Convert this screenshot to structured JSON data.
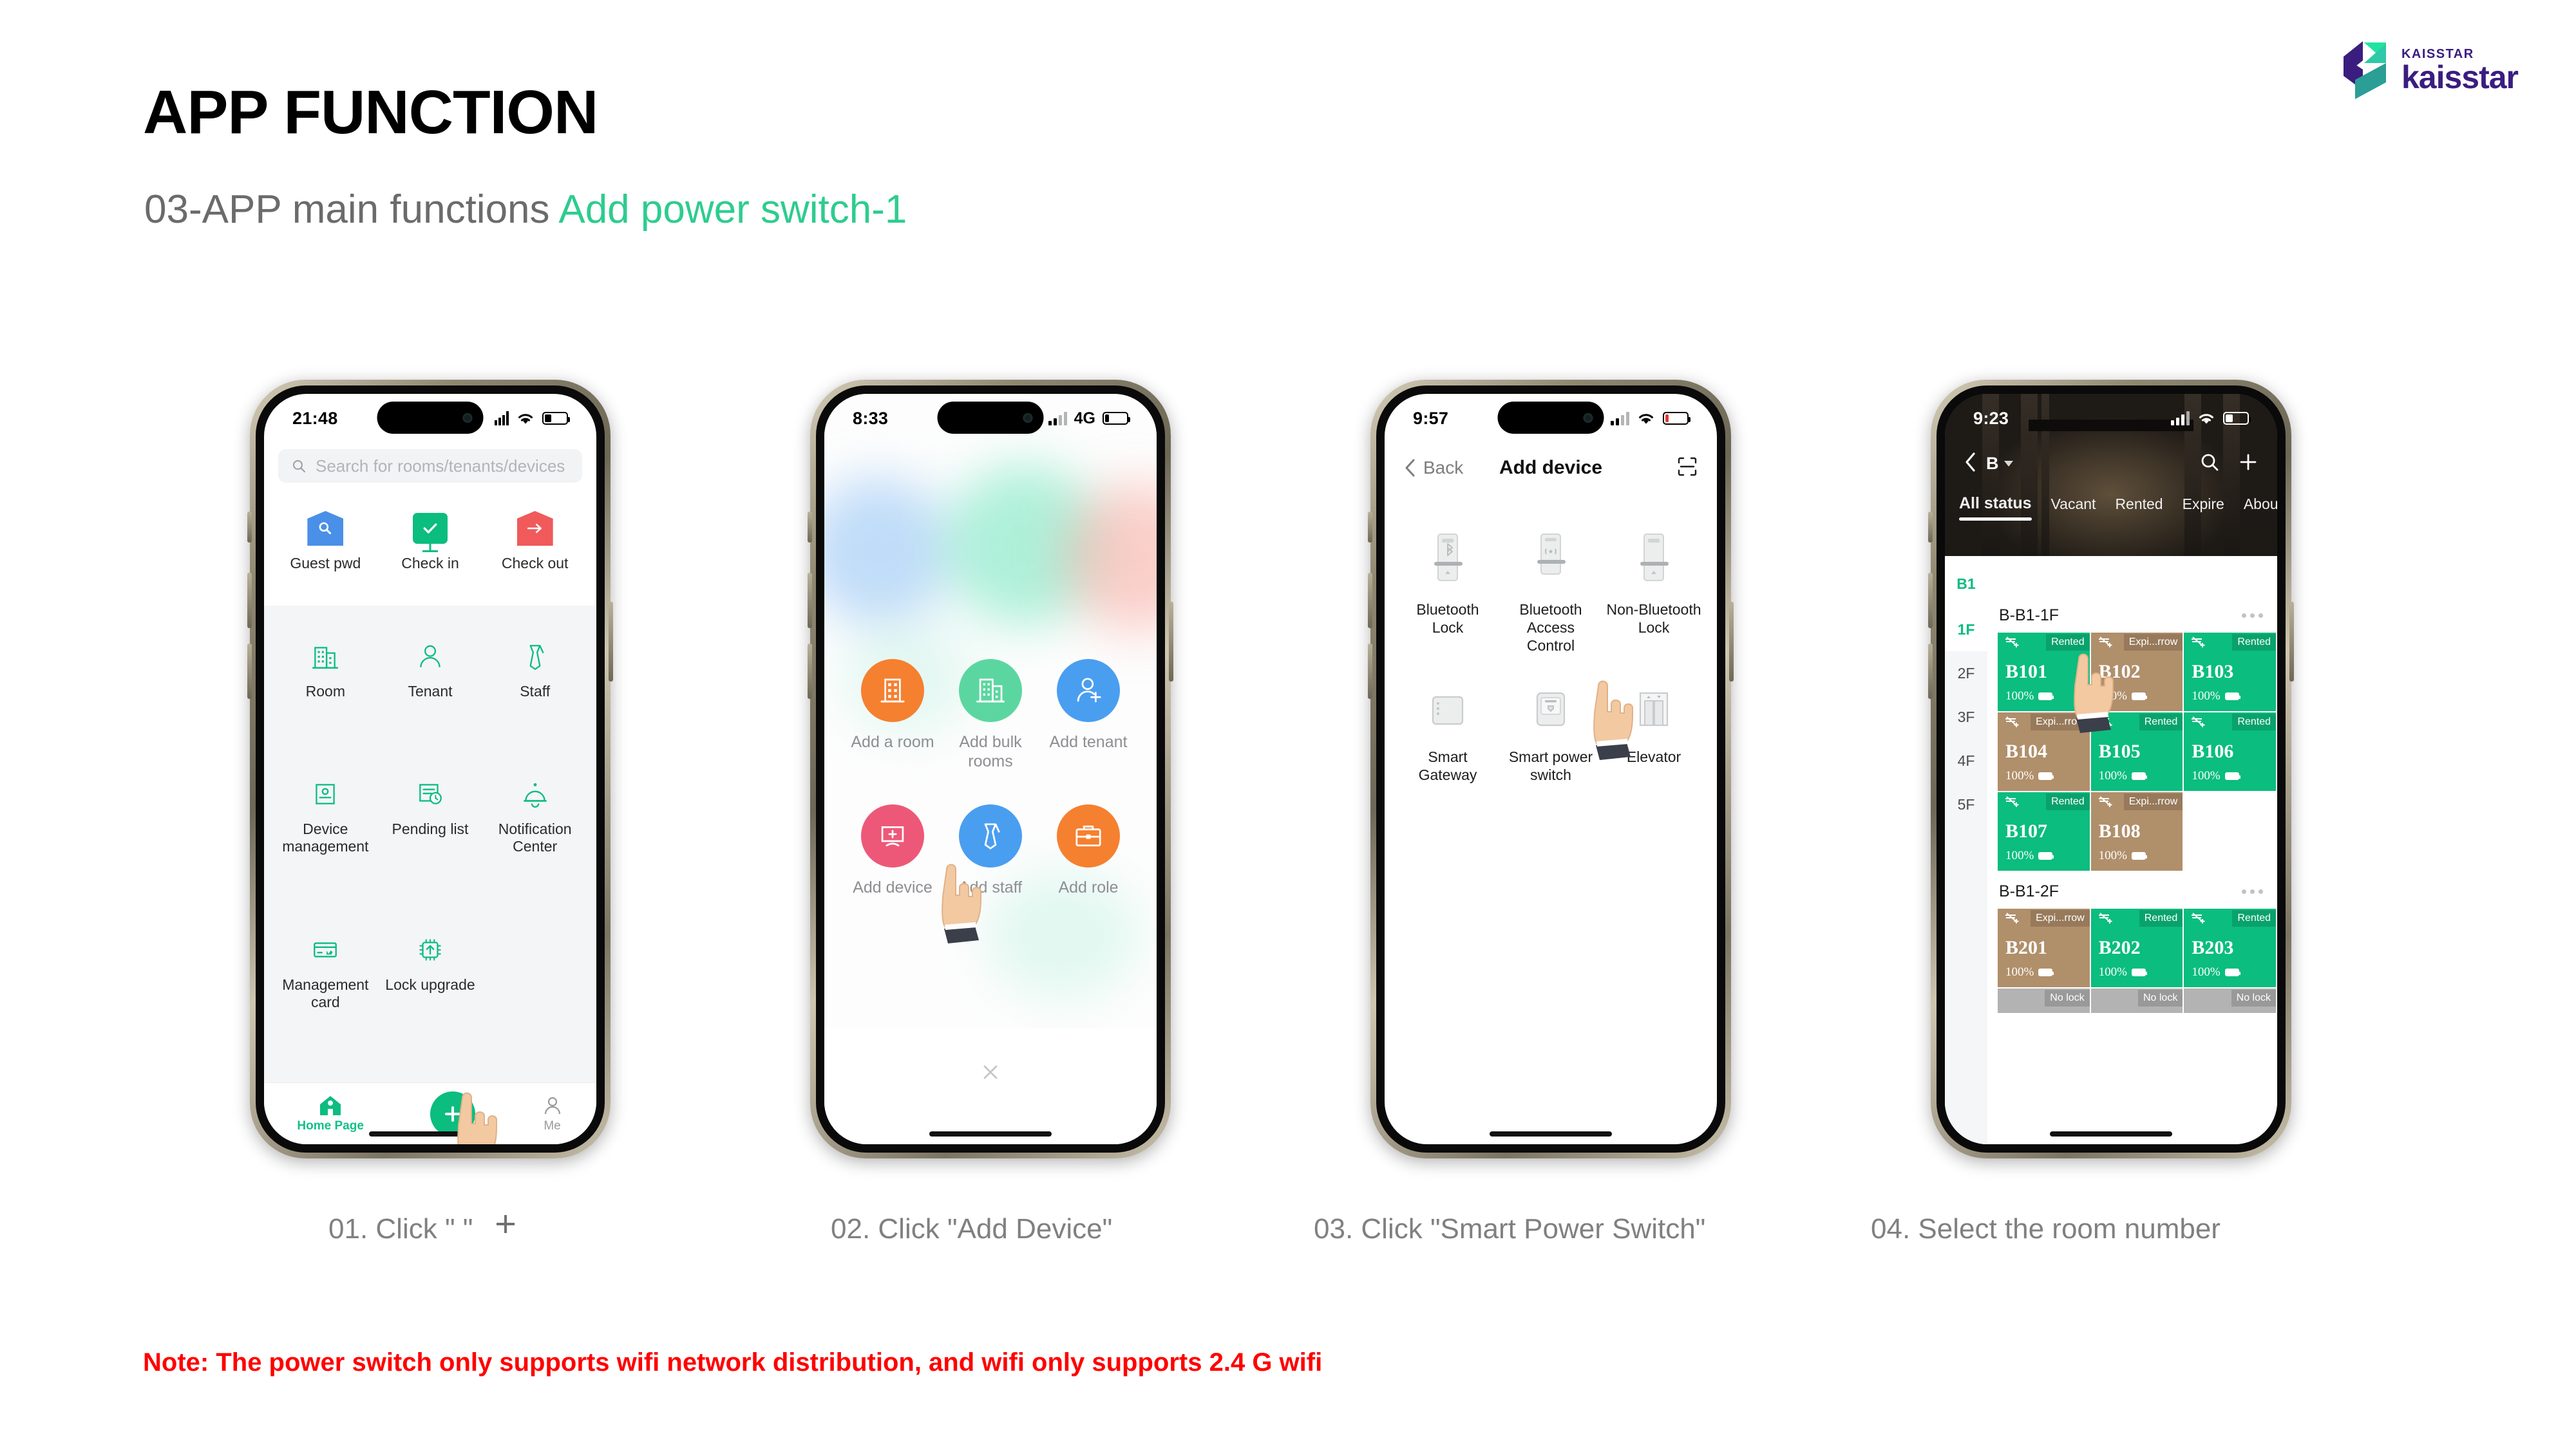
{
  "header": {
    "title": "APP FUNCTION",
    "subtitle_prefix": "03-APP main functions ",
    "subtitle_accent": "Add power switch-1",
    "accent_color": "#2ecc8f"
  },
  "logo": {
    "small_text": "KAISSTAR",
    "big_text": "kaisstar",
    "brand_color": "#3b1d80",
    "accent_color": "#1fd9a0"
  },
  "phone1": {
    "status": {
      "time": "21:48",
      "network": "",
      "battery_level": "30%"
    },
    "search": {
      "placeholder": "Search for rooms/tenants/devices"
    },
    "top_items": [
      {
        "label": "Guest pwd",
        "icon": "shield-search-icon",
        "color": "#4a90e8"
      },
      {
        "label": "Check in",
        "icon": "check-screen-icon",
        "color": "#0bbd7f"
      },
      {
        "label": "Check out",
        "icon": "shield-arrow-icon",
        "color": "#f05a5a"
      }
    ],
    "menu_items": [
      {
        "label": "Room",
        "icon": "building-icon"
      },
      {
        "label": "Tenant",
        "icon": "person-icon"
      },
      {
        "label": "Staff",
        "icon": "tie-icon"
      },
      {
        "label": "Device management",
        "icon": "device-card-icon"
      },
      {
        "label": "Pending list",
        "icon": "pending-clock-icon"
      },
      {
        "label": "Notification Center",
        "icon": "bell-icon"
      },
      {
        "label": "Management card",
        "icon": "management-card-icon"
      },
      {
        "label": "Lock upgrade",
        "icon": "chip-upload-icon"
      }
    ],
    "tabbar": [
      {
        "label": "Home Page",
        "icon": "home-icon",
        "active": true
      },
      {
        "label": "",
        "icon": "plus-fab-icon",
        "active": false
      },
      {
        "label": "Me",
        "icon": "person-outline-icon",
        "active": false
      }
    ]
  },
  "phone2": {
    "status": {
      "time": "8:33",
      "network": "4G",
      "battery_level": "20%"
    },
    "actions": [
      {
        "label": "Add a room",
        "icon": "building-icon",
        "color": "#f58030"
      },
      {
        "label": "Add bulk rooms",
        "icon": "buildings-icon",
        "color": "#5cd6a0"
      },
      {
        "label": "Add tenant",
        "icon": "person-plus-icon",
        "color": "#4a9ef0"
      },
      {
        "label": "Add device",
        "icon": "device-plus-icon",
        "color": "#ee5878"
      },
      {
        "label": "Add staff",
        "icon": "tie-icon",
        "color": "#4a9ef0"
      },
      {
        "label": "Add role",
        "icon": "briefcase-icon",
        "color": "#f58030"
      }
    ],
    "close_label": "close-icon"
  },
  "phone3": {
    "status": {
      "time": "9:57",
      "network": "",
      "battery_level": "15%"
    },
    "nav": {
      "back_label": "Back",
      "title": "Add device",
      "scan_icon": "scan-icon"
    },
    "devices": [
      {
        "label": "Bluetooth Lock",
        "icon": "bluetooth-lock-icon"
      },
      {
        "label": "Bluetooth Access Control",
        "icon": "bluetooth-access-icon"
      },
      {
        "label": "Non-Bluetooth Lock",
        "icon": "nonbluetooth-lock-icon"
      },
      {
        "label": "Smart Gateway",
        "icon": "gateway-icon"
      },
      {
        "label": "Smart power switch",
        "icon": "power-switch-icon"
      },
      {
        "label": "Elevator",
        "icon": "elevator-icon"
      }
    ]
  },
  "phone4": {
    "status": {
      "time": "9:23",
      "network": "",
      "battery_level": "35%"
    },
    "nav": {
      "building": "B",
      "back_icon": "back-chevron-icon",
      "dropdown_icon": "caret-down-icon",
      "search_icon": "search-icon",
      "add_icon": "plus-icon"
    },
    "tabs": [
      {
        "label": "All status",
        "active": true
      },
      {
        "label": "Vacant",
        "active": false
      },
      {
        "label": "Rented",
        "active": false
      },
      {
        "label": "Expire",
        "active": false
      },
      {
        "label": "About t",
        "active": false
      }
    ],
    "floors": [
      {
        "label": "B1",
        "selected": true,
        "header": true
      },
      {
        "label": "1F",
        "selected": true
      },
      {
        "label": "2F",
        "selected": false
      },
      {
        "label": "3F",
        "selected": false
      },
      {
        "label": "4F",
        "selected": false
      },
      {
        "label": "5F",
        "selected": false
      }
    ],
    "sections": [
      {
        "name": "B-B1-1F",
        "rooms": [
          {
            "number": "B101",
            "status": "Rented",
            "battery": "100%",
            "color": "green"
          },
          {
            "number": "B102",
            "status": "Expi...rrow",
            "battery": "100%",
            "color": "brown"
          },
          {
            "number": "B103",
            "status": "Rented",
            "battery": "100%",
            "color": "green"
          },
          {
            "number": "B104",
            "status": "Expi...rrow",
            "battery": "100%",
            "color": "brown"
          },
          {
            "number": "B105",
            "status": "Rented",
            "battery": "100%",
            "color": "green"
          },
          {
            "number": "B106",
            "status": "Rented",
            "battery": "100%",
            "color": "green"
          },
          {
            "number": "B107",
            "status": "Rented",
            "battery": "100%",
            "color": "green"
          },
          {
            "number": "B108",
            "status": "Expi...rrow",
            "battery": "100%",
            "color": "brown"
          },
          {
            "number": "",
            "status": "",
            "battery": "",
            "color": "empty"
          }
        ]
      },
      {
        "name": "B-B1-2F",
        "rooms": [
          {
            "number": "B201",
            "status": "Expi...rrow",
            "battery": "100%",
            "color": "brown"
          },
          {
            "number": "B202",
            "status": "Rented",
            "battery": "100%",
            "color": "green"
          },
          {
            "number": "B203",
            "status": "Rented",
            "battery": "100%",
            "color": "green"
          },
          {
            "number": "",
            "status": "No lock",
            "battery": "",
            "color": "grey"
          },
          {
            "number": "",
            "status": "No lock",
            "battery": "",
            "color": "grey"
          },
          {
            "number": "",
            "status": "No lock",
            "battery": "",
            "color": "grey"
          }
        ]
      }
    ]
  },
  "captions": [
    "01. Click \" \"",
    "02. Click \"Add Device\"",
    "03. Click \"Smart Power Switch\"",
    "04. Select the room number"
  ],
  "note": "Note: The power switch only supports wifi network distribution, and wifi only supports 2.4 G wifi",
  "note_color": "#ff0000"
}
